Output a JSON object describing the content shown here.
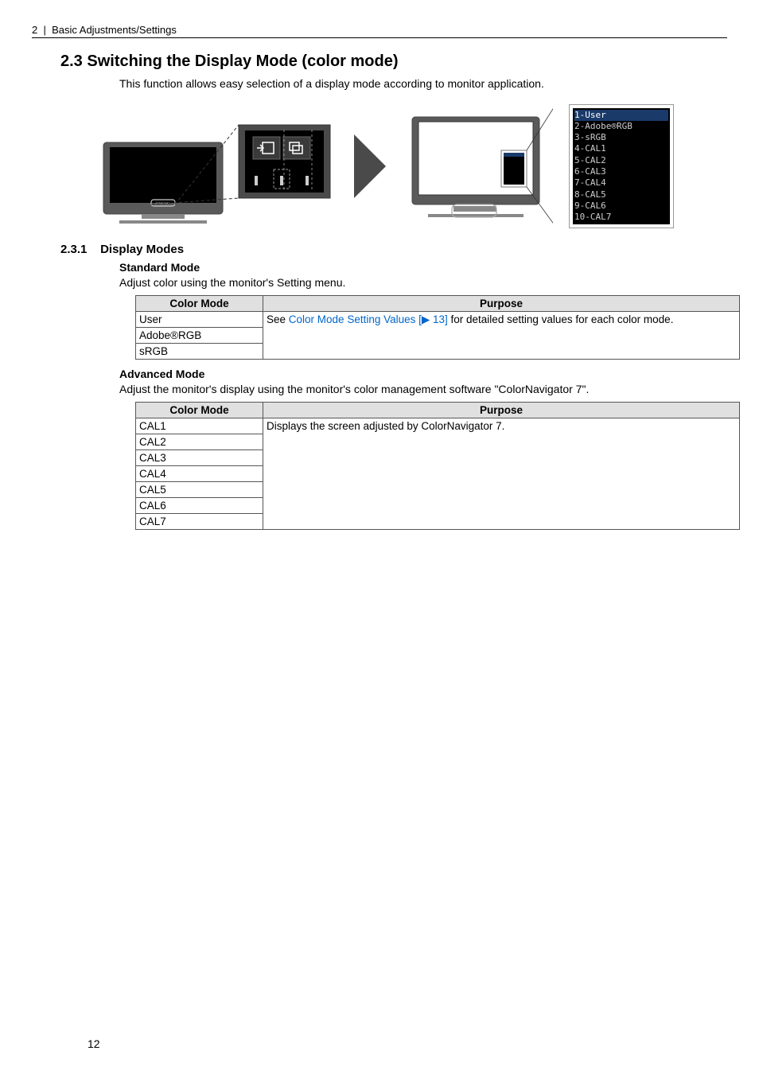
{
  "header": {
    "chapter": "2",
    "separator": "|",
    "title": "Basic Adjustments/Settings"
  },
  "section": {
    "number": "2.3",
    "title": "Switching the Display Mode (color mode)",
    "intro": "This function allows easy selection of a display mode according to monitor application."
  },
  "osd": {
    "items": [
      "1-User",
      "2-Adobe®RGB",
      "3-sRGB",
      "4-CAL1",
      "5-CAL2",
      "6-CAL3",
      "7-CAL4",
      "8-CAL5",
      "9-CAL6",
      "10-CAL7"
    ]
  },
  "subsection": {
    "number": "2.3.1",
    "title": "Display Modes"
  },
  "standard_mode": {
    "heading": "Standard Mode",
    "desc": "Adjust color using the monitor's Setting menu.",
    "headers": {
      "col1": "Color Mode",
      "col2": "Purpose"
    },
    "rows": [
      "User",
      "Adobe®RGB",
      "sRGB"
    ],
    "purpose_prefix": "See ",
    "purpose_link": "Color Mode Setting Values [▶ 13]",
    "purpose_suffix": " for detailed setting values for each color mode."
  },
  "advanced_mode": {
    "heading": "Advanced Mode",
    "desc": "Adjust the monitor's display using the monitor's color management software \"ColorNavigator 7\".",
    "headers": {
      "col1": "Color Mode",
      "col2": "Purpose"
    },
    "rows": [
      "CAL1",
      "CAL2",
      "CAL3",
      "CAL4",
      "CAL5",
      "CAL6",
      "CAL7"
    ],
    "purpose": "Displays the screen adjusted by ColorNavigator 7."
  },
  "page_number": "12"
}
